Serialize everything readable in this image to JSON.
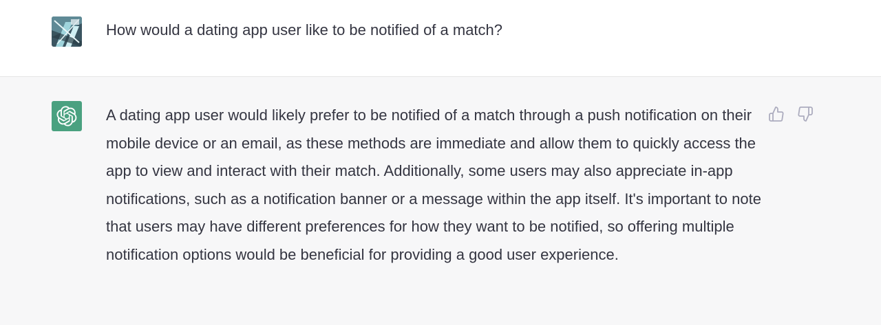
{
  "conversation": {
    "user_message": {
      "text": "How would a dating app user like to be notified of a match?",
      "avatar_icon": "user-avatar-image"
    },
    "assistant_message": {
      "text": "A dating app user would likely prefer to be notified of a match through a push notification on their mobile device or an email, as these methods are immediate and allow them to quickly access the app to view and interact with their match. Additionally, some users may also appreciate in-app notifications, such as a notification banner or a message within the app itself. It's important to note that users may have different preferences for how they want to be notified, so offering multiple notification options would be beneficial for providing a good user experience.",
      "avatar_icon": "openai-logo-icon",
      "avatar_color": "#4aa180"
    },
    "feedback": {
      "thumbs_up_icon": "thumbs-up-icon",
      "thumbs_down_icon": "thumbs-down-icon"
    }
  },
  "colors": {
    "text": "#343541",
    "user_bg": "#ffffff",
    "assistant_bg": "#f7f7f8",
    "icon_gray": "#acacbe"
  }
}
